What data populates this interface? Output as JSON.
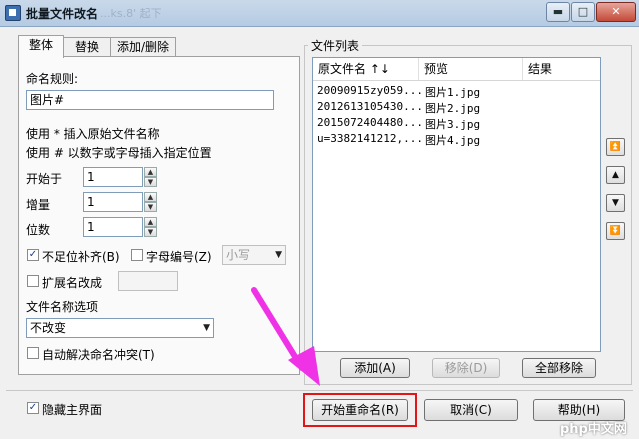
{
  "window": {
    "title": "批量文件改名",
    "title_ghost": "...ks.8' 起下",
    "minimize": "▬",
    "maximize": "□",
    "close": "✕"
  },
  "tabs": [
    {
      "label": "整体"
    },
    {
      "label": "替换"
    },
    {
      "label": "添加/删除"
    }
  ],
  "rules": {
    "label": "命名规则:",
    "value": "图片#",
    "hint1": "使用 * 插入原始文件名称",
    "hint2": "使用 # 以数字或字母插入指定位置",
    "start_label": "开始于",
    "start_value": "1",
    "step_label": "增量",
    "step_value": "1",
    "digits_label": "位数",
    "digits_value": "1",
    "pad_label": "不足位补齐(B)",
    "pad_checked": true,
    "letter_label": "字母编号(Z)",
    "letter_checked": false,
    "case_value": "小写",
    "ext_label": "扩展名改成",
    "ext_checked": false,
    "ext_value": "",
    "name_options_label": "文件名称选项",
    "name_options_value": "不改变",
    "autoresolve_label": "自动解决命名冲突(T)",
    "autoresolve_checked": false
  },
  "filelist": {
    "label": "文件列表",
    "columns": [
      "原文件名 ↑↓",
      "预览",
      "结果"
    ],
    "rows": [
      {
        "original": "20090915zy059...",
        "preview": "图片1.jpg",
        "result": ""
      },
      {
        "original": "2012613105430...",
        "preview": "图片2.jpg",
        "result": ""
      },
      {
        "original": "2015072404480...",
        "preview": "图片3.jpg",
        "result": ""
      },
      {
        "original": "u=3382141212,...",
        "preview": "图片4.jpg",
        "result": ""
      }
    ],
    "add": "添加(A)",
    "remove": "移除(D)",
    "remove_all": "全部移除"
  },
  "side_buttons": [
    "⏫",
    "▲",
    "▼",
    "⏬"
  ],
  "bottom": {
    "hide_main_label": "隐藏主界面",
    "hide_main_checked": true,
    "start": "开始重命名(R)",
    "cancel": "取消(C)",
    "help": "帮助(H)"
  },
  "watermark": "php中文网",
  "colors": {
    "highlight_box": "#e21616",
    "arrow": "#f032e6"
  }
}
